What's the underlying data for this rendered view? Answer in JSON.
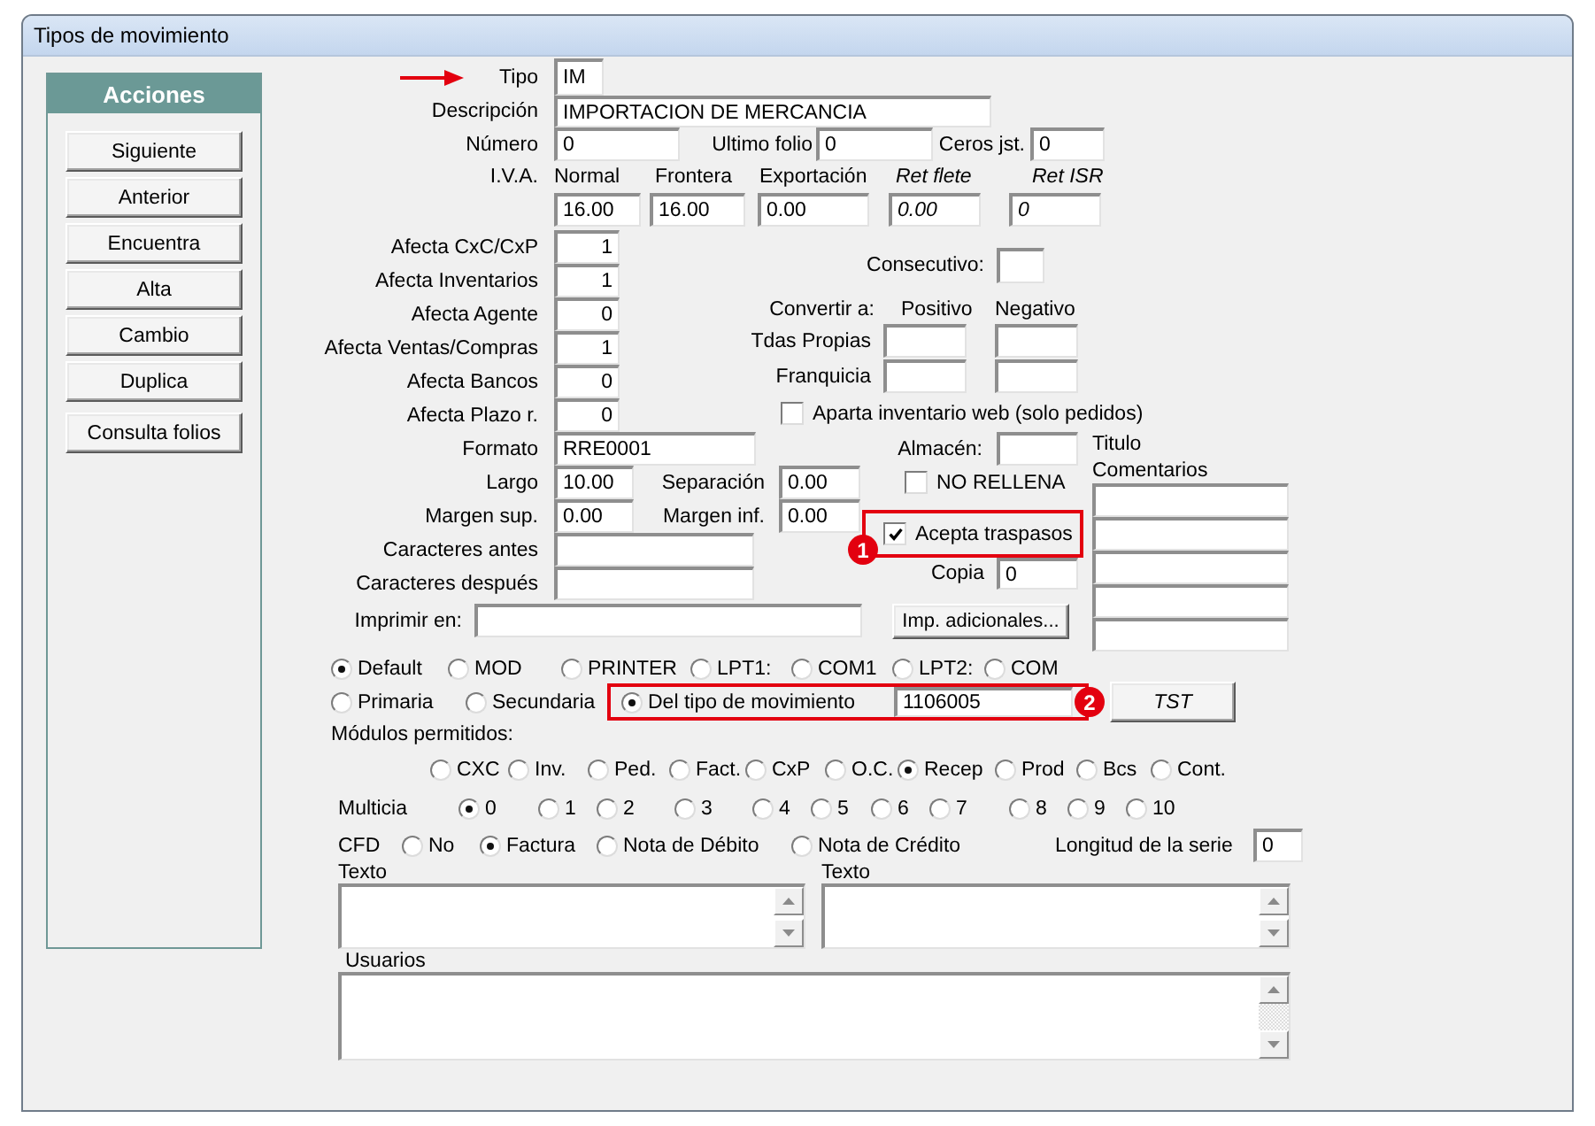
{
  "window": {
    "title": "Tipos de movimiento"
  },
  "sidebar": {
    "title": "Acciones",
    "buttons": [
      "Siguiente",
      "Anterior",
      "Encuentra",
      "Alta",
      "Cambio",
      "Duplica"
    ],
    "extra_button": "Consulta folios"
  },
  "header_fields": {
    "tipo": {
      "label": "Tipo",
      "value": "IM"
    },
    "descripcion": {
      "label": "Descripción",
      "value": "IMPORTACION DE MERCANCIA"
    },
    "numero": {
      "label": "Número",
      "value": "0"
    },
    "ultimo_folio": {
      "label": "Ultimo folio",
      "value": "0"
    },
    "ceros_jst": {
      "label": "Ceros jst.",
      "value": "0"
    }
  },
  "iva": {
    "label": "I.V.A.",
    "rates": [
      {
        "label": "Normal",
        "value": "16.00",
        "kind": "rate"
      },
      {
        "label": "Frontera",
        "value": "16.00",
        "kind": "rate"
      },
      {
        "label": "Exportación",
        "value": "0.00",
        "kind": "rate"
      },
      {
        "label": "Ret flete",
        "value": "0.00",
        "kind": "retention"
      },
      {
        "label": "Ret ISR",
        "value": "0",
        "kind": "retention"
      }
    ]
  },
  "afecta": [
    {
      "label": "Afecta CxC/CxP",
      "value": "1"
    },
    {
      "label": "Afecta Inventarios",
      "value": "1"
    },
    {
      "label": "Afecta Agente",
      "value": "0"
    },
    {
      "label": "Afecta Ventas/Compras",
      "value": "1"
    },
    {
      "label": "Afecta Bancos",
      "value": "0"
    },
    {
      "label": "Afecta Plazo r.",
      "value": "0"
    }
  ],
  "consecutivo": {
    "label": "Consecutivo:"
  },
  "convertir": {
    "label": "Convertir a:",
    "columns": [
      "Positivo",
      "Negativo"
    ],
    "rows": [
      "Tdas Propias",
      "Franquicia"
    ]
  },
  "aparta_web": {
    "label": "Aparta inventario web (solo pedidos)",
    "checked": false
  },
  "formato": {
    "label": "Formato",
    "value": "RRE0001"
  },
  "almacen": {
    "label": "Almacén:"
  },
  "comentarios": {
    "title_label": "Titulo",
    "label": "Comentarios"
  },
  "largo": {
    "label": "Largo",
    "value": "10.00"
  },
  "separacion": {
    "label": "Separación",
    "value": "0.00"
  },
  "no_rellena": {
    "label": "NO RELLENA",
    "checked": false
  },
  "margen_sup": {
    "label": "Margen sup.",
    "value": "0.00"
  },
  "margen_inf": {
    "label": "Margen inf.",
    "value": "0.00"
  },
  "acepta_traspasos": {
    "label": "Acepta traspasos",
    "checked": true,
    "callout": "1"
  },
  "caracteres_antes": {
    "label": "Caracteres antes"
  },
  "caracteres_despues": {
    "label": "Caracteres después"
  },
  "copia": {
    "label": "Copia",
    "value": "0"
  },
  "imprimir_en": {
    "label": "Imprimir en:",
    "button": "Imp. adicionales..."
  },
  "print_port": [
    {
      "label": "Default",
      "selected": true
    },
    {
      "label": "MOD",
      "selected": false
    },
    {
      "label": "PRINTER",
      "selected": false
    },
    {
      "label": "LPT1:",
      "selected": false
    },
    {
      "label": "COM1",
      "selected": false
    },
    {
      "label": "LPT2:",
      "selected": false
    },
    {
      "label": "COM",
      "selected": false
    }
  ],
  "print_source": {
    "options": [
      {
        "label": "Primaria",
        "selected": false,
        "kind": "plain"
      },
      {
        "label": "Secundaria",
        "selected": false,
        "kind": "plain"
      },
      {
        "label": "Del tipo de movimiento",
        "selected": true,
        "kind": "with_value",
        "value": "1106005",
        "callout": "2"
      }
    ],
    "button": "TST"
  },
  "modulos": {
    "label": "Módulos permitidos:",
    "options": [
      {
        "label": "CXC",
        "selected": false
      },
      {
        "label": "Inv.",
        "selected": false
      },
      {
        "label": "Ped.",
        "selected": false
      },
      {
        "label": "Fact.",
        "selected": false
      },
      {
        "label": "CxP",
        "selected": false
      },
      {
        "label": "O.C.",
        "selected": false
      },
      {
        "label": "Recep",
        "selected": true
      },
      {
        "label": "Prod",
        "selected": false
      },
      {
        "label": "Bcs",
        "selected": false
      },
      {
        "label": "Cont.",
        "selected": false
      }
    ]
  },
  "multicia": {
    "label": "Multicia",
    "options": [
      {
        "label": "0",
        "selected": true
      },
      {
        "label": "1",
        "selected": false
      },
      {
        "label": "2",
        "selected": false
      },
      {
        "label": "3",
        "selected": false
      },
      {
        "label": "4",
        "selected": false
      },
      {
        "label": "5",
        "selected": false
      },
      {
        "label": "6",
        "selected": false
      },
      {
        "label": "7",
        "selected": false
      },
      {
        "label": "8",
        "selected": false
      },
      {
        "label": "9",
        "selected": false
      },
      {
        "label": "10",
        "selected": false
      }
    ]
  },
  "cfd": {
    "label": "CFD",
    "options": [
      {
        "label": "No",
        "selected": false
      },
      {
        "label": "Factura",
        "selected": true
      },
      {
        "label": "Nota de Débito",
        "selected": false
      },
      {
        "label": "Nota de Crédito",
        "selected": false
      }
    ]
  },
  "longitud_serie": {
    "label": "Longitud de la serie",
    "value": "0"
  },
  "texto": [
    {
      "label": "Texto"
    },
    {
      "label": "Texto"
    }
  ],
  "usuarios": {
    "label": "Usuarios"
  }
}
